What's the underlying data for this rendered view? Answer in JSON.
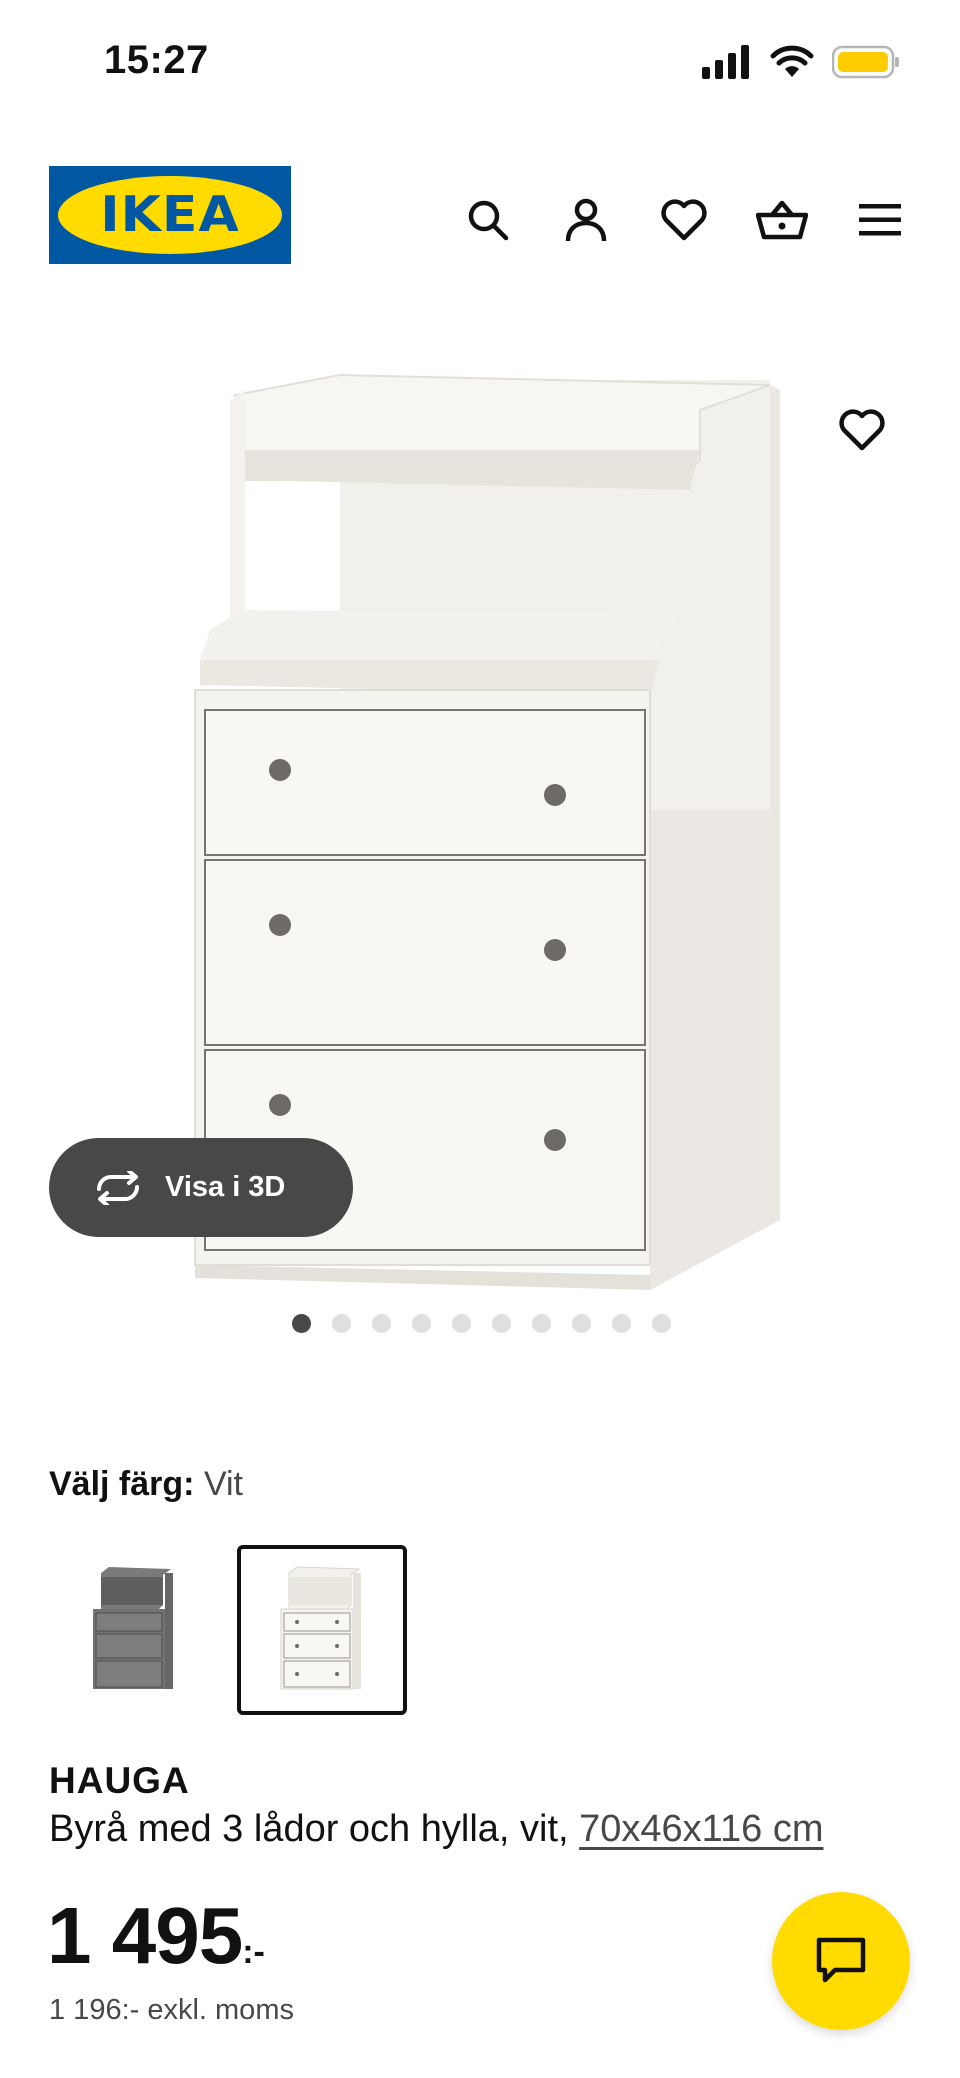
{
  "status_bar": {
    "time": "15:27",
    "icons": [
      "signal-icon",
      "wifi-icon",
      "battery-icon"
    ]
  },
  "header": {
    "logo_text": "IKEA",
    "icons": [
      "search-icon",
      "account-icon",
      "favorites-heart-icon",
      "shopping-basket-icon",
      "menu-icon"
    ]
  },
  "gallery": {
    "view_3d_label": "Visa i 3D",
    "image_count": 10,
    "active_index": 0
  },
  "color_select": {
    "label": "Välj färg:",
    "value": "Vit",
    "options": [
      {
        "name": "grå",
        "selected": false
      },
      {
        "name": "vit",
        "selected": true
      }
    ]
  },
  "product": {
    "name": "HAUGA",
    "description": "Byrå med 3 lådor och hylla, vit,",
    "dimensions": "70x46x116 cm",
    "price_integer": "1 495",
    "price_suffix": ":-",
    "price_excl_vat": "1 196:- exkl. moms"
  },
  "colors": {
    "ikea_blue": "#0058a3",
    "ikea_yellow": "#ffdb00",
    "dark_gray": "#484848"
  }
}
